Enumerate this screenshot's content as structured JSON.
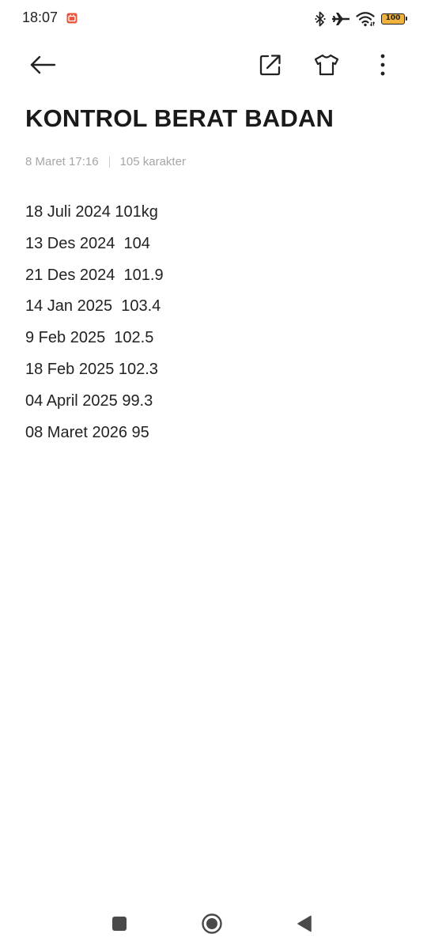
{
  "status_bar": {
    "time": "18:07",
    "battery": "100",
    "icons": [
      "notification-app-icon",
      "bluetooth-icon",
      "airplane-mode-icon",
      "wifi-icon",
      "battery-icon"
    ]
  },
  "toolbar": {
    "icons": [
      "back-arrow-icon",
      "share-icon",
      "theme-shirt-icon",
      "more-vert-icon"
    ]
  },
  "note": {
    "title": "KONTROL BERAT BADAN",
    "date": "8 Maret 17:16",
    "char_count": "105 karakter",
    "lines": [
      "18 Juli 2024 101kg",
      "13 Des 2024  104",
      "21 Des 2024  101.9",
      "14 Jan 2025  103.4",
      "9 Feb 2025  102.5",
      "18 Feb 2025 102.3",
      "04 April 2025 99.3",
      "08 Maret 2026 95"
    ]
  },
  "nav_bar": {
    "icons": [
      "recents-square-icon",
      "home-circle-icon",
      "back-triangle-icon"
    ]
  },
  "colors": {
    "background": "#ffffff",
    "text": "#222222",
    "meta_text": "#a6a6a6",
    "battery_fill": "#f2b33d",
    "notification_badge": "#e8553a"
  }
}
